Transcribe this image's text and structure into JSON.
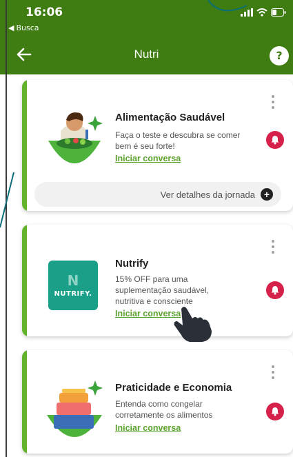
{
  "status_bar": {
    "time": "16:06",
    "back_app": "Busca"
  },
  "header": {
    "title": "Nutri",
    "help_label": "?"
  },
  "cards": [
    {
      "title": "Alimentação Saudável",
      "description": "Faça o teste e descubra se comer bem é seu forte!",
      "link": "Iniciar conversa",
      "journey_label": "Ver detalhes da jornada",
      "journey_icon": "+",
      "image": "person-salad-illustration"
    },
    {
      "title": "Nutrify",
      "description": "15% OFF para uma suplementação saudável, nutritiva e consciente",
      "link": "Iniciar conversa",
      "logo_text": "NUTRIFY.",
      "logo_mark": "N"
    },
    {
      "title": "Praticidade e Economia",
      "description": "Entenda como congelar corretamente os alimentos",
      "link": "Iniciar conversa",
      "image": "stacked-containers-illustration"
    }
  ],
  "colors": {
    "header_green": "#3f7d12",
    "accent_green": "#62b32c",
    "link_green": "#5aa22d",
    "bell_red": "#d6224a",
    "nutrify_teal": "#1aa089"
  }
}
